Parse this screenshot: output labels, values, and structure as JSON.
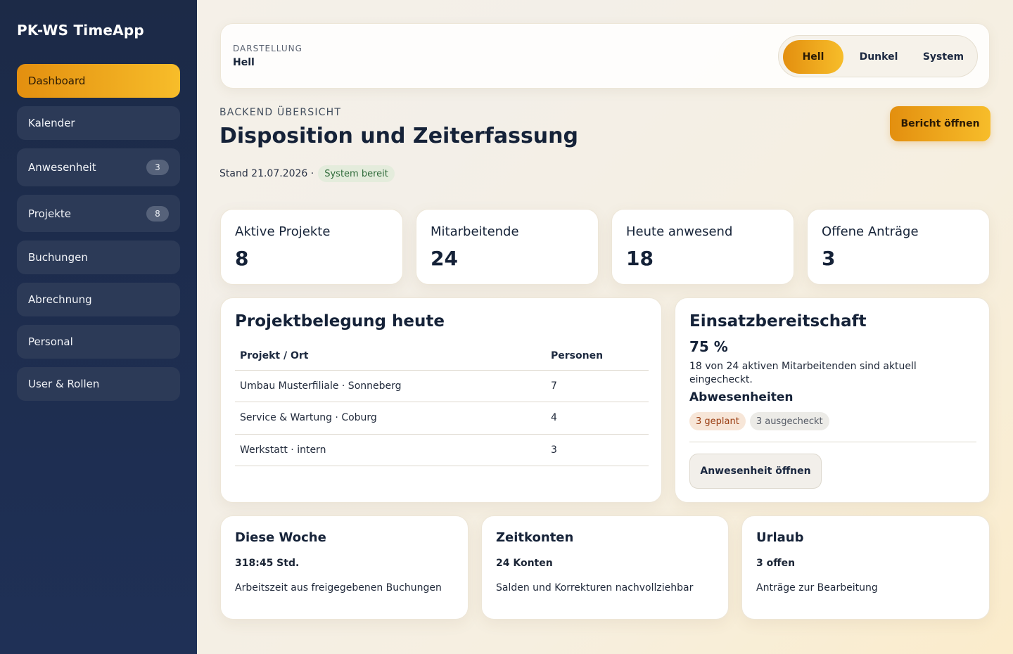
{
  "app": {
    "title": "PK-WS TimeApp"
  },
  "sidebar": {
    "items": [
      {
        "label": "Dashboard",
        "badge": ""
      },
      {
        "label": "Kalender",
        "badge": ""
      },
      {
        "label": "Anwesenheit",
        "badge": "3"
      },
      {
        "label": "Projekte",
        "badge": "8"
      },
      {
        "label": "Buchungen",
        "badge": ""
      },
      {
        "label": "Abrechnung",
        "badge": ""
      },
      {
        "label": "Personal",
        "badge": ""
      },
      {
        "label": "User & Rollen",
        "badge": ""
      }
    ]
  },
  "theme": {
    "kicker": "DARSTELLUNG",
    "current": "Hell",
    "options": [
      "Hell",
      "Dunkel",
      "System"
    ]
  },
  "header": {
    "kicker": "BACKEND ÜBERSICHT",
    "title": "Disposition und Zeiterfassung",
    "stand": "Stand 21.07.2026 ·",
    "status": "System bereit",
    "report_button": "Bericht öffnen"
  },
  "stats": [
    {
      "label": "Aktive Projekte",
      "value": "8"
    },
    {
      "label": "Mitarbeitende",
      "value": "24"
    },
    {
      "label": "Heute anwesend",
      "value": "18"
    },
    {
      "label": "Offene Anträge",
      "value": "3"
    }
  ],
  "projects": {
    "title": "Projektbelegung heute",
    "columns": [
      "Projekt / Ort",
      "Personen"
    ],
    "rows": [
      {
        "name": "Umbau Musterfiliale · Sonneberg",
        "count": "7"
      },
      {
        "name": "Service & Wartung · Coburg",
        "count": "4"
      },
      {
        "name": "Werkstatt · intern",
        "count": "3"
      }
    ]
  },
  "readiness": {
    "title": "Einsatzbereitschaft",
    "percent": "75 %",
    "description": "18 von 24 aktiven Mitarbeitenden sind aktuell eingecheckt.",
    "absences_title": "Abwesenheiten",
    "chip_planned": "3 geplant",
    "chip_checked": "3 ausgecheckt",
    "button": "Anwesenheit öffnen"
  },
  "bottom": [
    {
      "title": "Diese Woche",
      "value": "318:45 Std.",
      "desc": "Arbeitszeit aus freigegebenen Buchungen"
    },
    {
      "title": "Zeitkonten",
      "value": "24 Konten",
      "desc": "Salden und Korrekturen nachvollziehbar"
    },
    {
      "title": "Urlaub",
      "value": "3 offen",
      "desc": "Anträge zur Bearbeitung"
    }
  ],
  "colors": {
    "sidebar": "#1c2a47",
    "accent_start": "#e38f0f",
    "accent_end": "#f7bd2a",
    "status_green": "#2f6b3a"
  }
}
